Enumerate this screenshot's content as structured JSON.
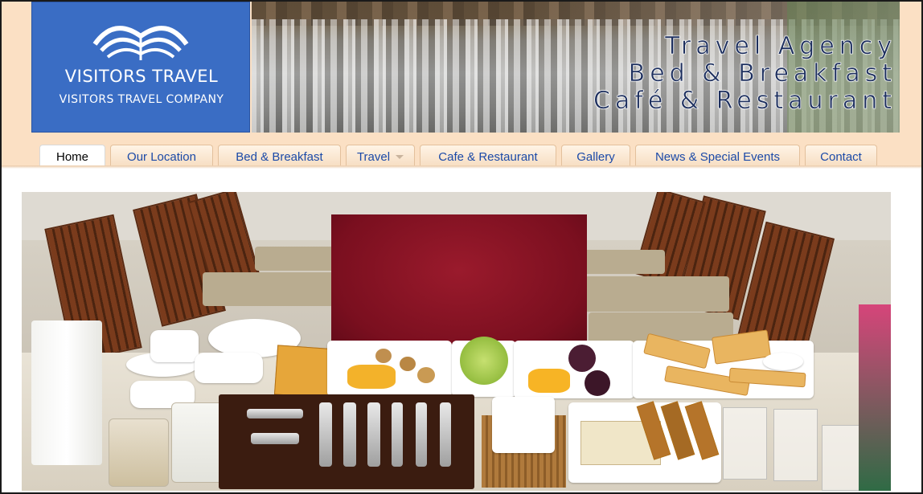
{
  "logo": {
    "name": "VISITORS TRAVEL",
    "tagline": "VISITORS TRAVEL COMPANY",
    "icon": "open-book-icon"
  },
  "banner": {
    "line1": "Travel Agency",
    "line2": "Bed & Breakfast",
    "line3": "Café & Restaurant"
  },
  "nav": {
    "items": [
      {
        "label": "Home",
        "active": true
      },
      {
        "label": "Our Location"
      },
      {
        "label": "Bed & Breakfast"
      },
      {
        "label": "Travel",
        "dropdown": true
      },
      {
        "label": "Cafe & Restaurant"
      },
      {
        "label": "Gallery"
      },
      {
        "label": "News & Special Events"
      },
      {
        "label": "Contact"
      }
    ]
  },
  "colors": {
    "header_bg": "#fbe0c4",
    "logo_bg": "#3a6dc4",
    "tab_text": "#1b4aa8",
    "banner_text": "#1d2f5e"
  }
}
